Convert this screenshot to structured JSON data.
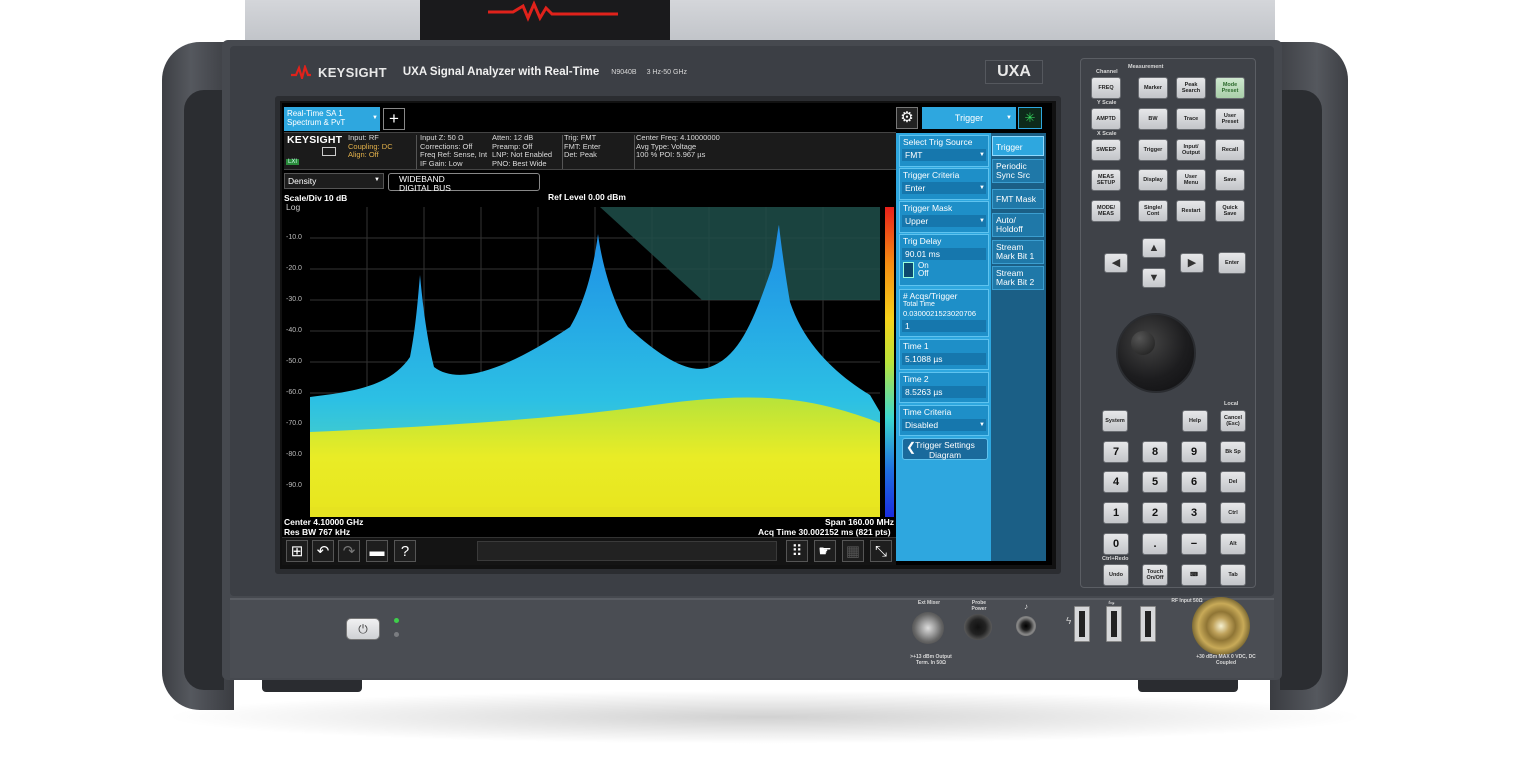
{
  "header": {
    "brand": "KEYSIGHT",
    "model_line": "UXA Signal Analyzer with Real-Time",
    "model_number": "N9040B",
    "freq_range": "3 Hz-50 GHz",
    "badge": "UXA"
  },
  "screen": {
    "mode_tab": {
      "line1": "Real-Time SA 1",
      "line2": "Spectrum & PvT"
    },
    "add_tab": "+",
    "menu_title": "Trigger",
    "status": {
      "logo": "KEYSIGHT",
      "lxi": "LXI",
      "col1": [
        "Input: RF",
        "Coupling: DC",
        "Align: Off"
      ],
      "col2": [
        "Input Z: 50 Ω",
        "Corrections: Off",
        "Freq Ref: Sense, Int",
        "IF Gain: Low"
      ],
      "col3": [
        "Atten: 12 dB",
        "Preamp: Off",
        "LNP: Not Enabled",
        "PNO: Best Wide"
      ],
      "col4": [
        "Trig: FMT",
        "FMT: Enter",
        "Det: Peak"
      ],
      "col5": [
        "Center Freq: 4.10000000",
        "Avg Type: Voltage",
        "100 % POI: 5.967 µs"
      ]
    },
    "view_select": "Density",
    "digital_bus": {
      "line1": "WIDEBAND",
      "line2": "DIGITAL BUS"
    },
    "scale": "Scale/Div 10 dB",
    "scale_type": "Log",
    "ref_level": "Ref Level 0.00 dBm",
    "y_ticks": [
      "-10.0",
      "-20.0",
      "-30.0",
      "-40.0",
      "-50.0",
      "-60.0",
      "-70.0",
      "-80.0",
      "-90.0"
    ],
    "center": "Center 4.10000 GHz",
    "res_bw": "Res BW 767 kHz",
    "span": "Span 160.00 MHz",
    "acq_time": "Acq Time 30.002152 ms (821 pts)",
    "panel": {
      "trig_source_label": "Select Trig Source",
      "trig_source_value": "FMT",
      "criteria_label": "Trigger Criteria",
      "criteria_value": "Enter",
      "mask_label": "Trigger Mask",
      "mask_value": "Upper",
      "delay_label": "Trig Delay",
      "delay_value": "90.01 ms",
      "delay_on": "On",
      "delay_off": "Off",
      "acqs_label": "# Acqs/Trigger",
      "total_time_label": "Total Time",
      "total_time_value": "0.0300021523020706",
      "acqs_value": "1",
      "time1_label": "Time 1",
      "time1_value": "5.1088 µs",
      "time2_label": "Time 2",
      "time2_value": "8.5263 µs",
      "time_criteria_label": "Time Criteria",
      "time_criteria_value": "Disabled",
      "diagram_button_line1": "Trigger Settings",
      "diagram_button_line2": "Diagram"
    },
    "softkeys": {
      "trigger": "Trigger",
      "periodic_1": "Periodic",
      "periodic_2": "Sync Src",
      "fmt_mask": "FMT Mask",
      "auto_1": "Auto/",
      "auto_2": "Holdoff",
      "stream1_1": "Stream",
      "stream1_2": "Mark Bit 1",
      "stream2_1": "Stream",
      "stream2_2": "Mark Bit 2"
    }
  },
  "keypad": {
    "group_channel": "Channel",
    "group_measurement": "Measurement",
    "group_yscale": "Y Scale",
    "group_xscale": "X Scale",
    "freq": "FREQ",
    "marker": "Marker",
    "peak_search": "Peak Search",
    "mode_preset": "Mode Preset",
    "amptd": "AMPTD",
    "bw": "BW",
    "trace": "Trace",
    "user_preset": "User Preset",
    "sweep": "SWEEP",
    "trigger": "Trigger",
    "input_output": "Input/ Output",
    "recall": "Recall",
    "meas_setup": "MEAS SETUP",
    "display": "Display",
    "user_menu": "User Menu",
    "save": "Save",
    "mode_meas": "MODE/ MEAS",
    "single_cont": "Single/ Cont",
    "restart": "Restart",
    "quick_save": "Quick Save",
    "enter": "Enter",
    "system": "System",
    "help": "Help",
    "local": "Local",
    "cancel_esc": "Cancel (Esc)",
    "num7": "7",
    "num8": "8",
    "num9": "9",
    "bksp": "Bk Sp",
    "num4": "4",
    "num5": "5",
    "num6": "6",
    "del": "Del",
    "num1": "1",
    "num2": "2",
    "num3": "3",
    "ctrl": "Ctrl",
    "num0": "0",
    "dot": ".",
    "minus": "−",
    "alt": "Alt",
    "ctrl_redo": "Ctrl+Redo",
    "undo": "Undo",
    "touch": "Touch On/Off",
    "tab": "Tab"
  },
  "front": {
    "ext_mixer": "Ext Mixer",
    "probe_power": "Probe Power",
    "mixer_note": ">+13 dBm Output Term. In 50Ω",
    "rf_input": "RF Input 50Ω",
    "rf_note": "+30 dBm MAX 0 VDC, DC Coupled"
  },
  "colors": {
    "accent": "#2ea7df",
    "panel_dark": "#1b5f86",
    "lxi_green": "#2a8a3a"
  }
}
